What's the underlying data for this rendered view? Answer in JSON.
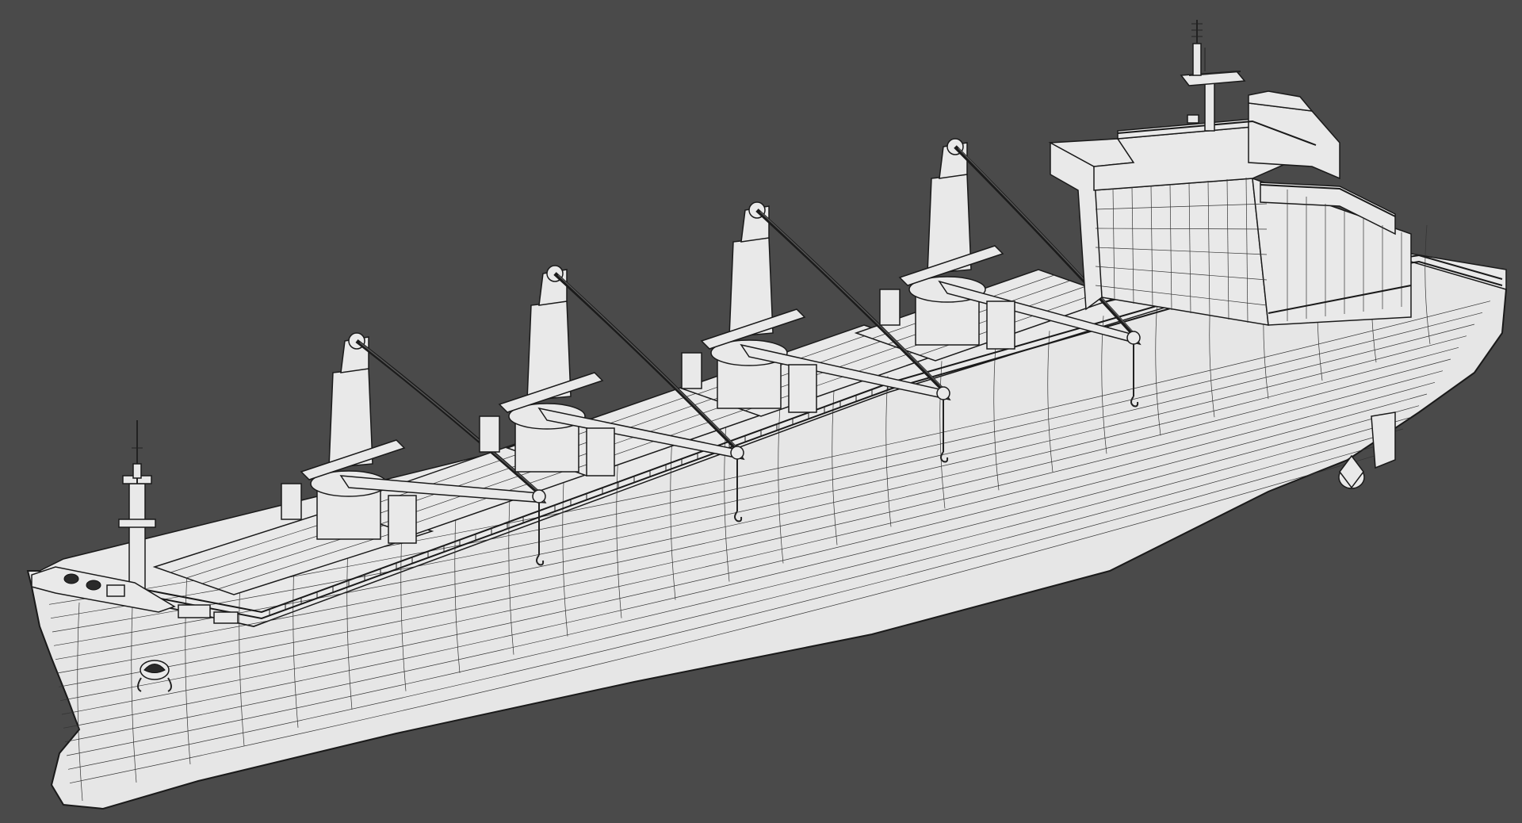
{
  "scene": {
    "background_color": "#4a4a4a",
    "model_fill_color": "#e6e6e6",
    "wire_color": "#222222",
    "render_style": "wireframe-shaded",
    "subject": "bulk-carrier-ship",
    "crane_count": 4
  }
}
